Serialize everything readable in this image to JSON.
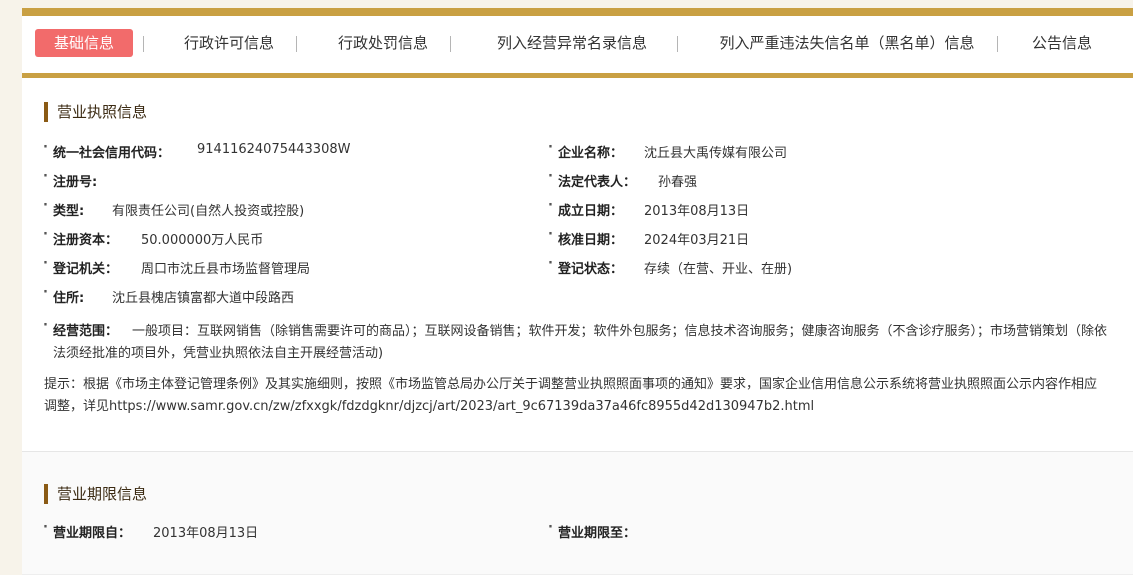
{
  "tabs": [
    {
      "label": "基础信息"
    },
    {
      "label": "行政许可信息"
    },
    {
      "label": "行政处罚信息"
    },
    {
      "label": "列入经营异常名录信息"
    },
    {
      "label": "列入严重违法失信名单（黑名单）信息"
    },
    {
      "label": "公告信息"
    }
  ],
  "license": {
    "title": "营业执照信息",
    "credit_code_label": "统一社会信用代码：",
    "credit_code": "91411624075443308W",
    "company_name_label": "企业名称：",
    "company_name": "沈丘县大禹传媒有限公司",
    "reg_no_label": "注册号:",
    "reg_no": "",
    "legal_rep_label": "法定代表人：",
    "legal_rep": "孙春强",
    "type_label": "类型:",
    "type": "有限责任公司(自然人投资或控股)",
    "est_date_label": "成立日期：",
    "est_date": "2013年08月13日",
    "capital_label": "注册资本：",
    "capital": "50.000000万人民币",
    "approval_date_label": "核准日期：",
    "approval_date": "2024年03月21日",
    "authority_label": "登记机关：",
    "authority": "周口市沈丘县市场监督管理局",
    "status_label": "登记状态：",
    "status": "存续（在营、开业、在册)",
    "address_label": "住所:",
    "address": "沈丘县槐店镇富都大道中段路西",
    "scope_label": "经营范围：",
    "scope": "一般项目：互联网销售（除销售需要许可的商品）；互联网设备销售；软件开发；软件外包服务；信息技术咨询服务；健康咨询服务（不含诊疗服务）；市场营销策划（除依法须经批准的项目外，凭营业执照依法自主开展经营活动)",
    "notice": "提示：根据《市场主体登记管理条例》及其实施细则，按照《市场监管总局办公厅关于调整营业执照照面事项的通知》要求，国家企业信用信息公示系统将营业执照照面公示内容作相应调整，详见https://www.samr.gov.cn/zw/zfxxgk/fdzdgknr/djzcj/art/2023/art_9c67139da37a46fc8955d42d130947b2.html"
  },
  "term": {
    "title": "营业期限信息",
    "from_label": "营业期限自：",
    "from": "2013年08月13日",
    "to_label": "营业期限至：",
    "to": ""
  },
  "colors": {
    "accent_gold": "#c9a043",
    "active_tab": "#f26b6b",
    "section_marker": "#8a5a14"
  }
}
